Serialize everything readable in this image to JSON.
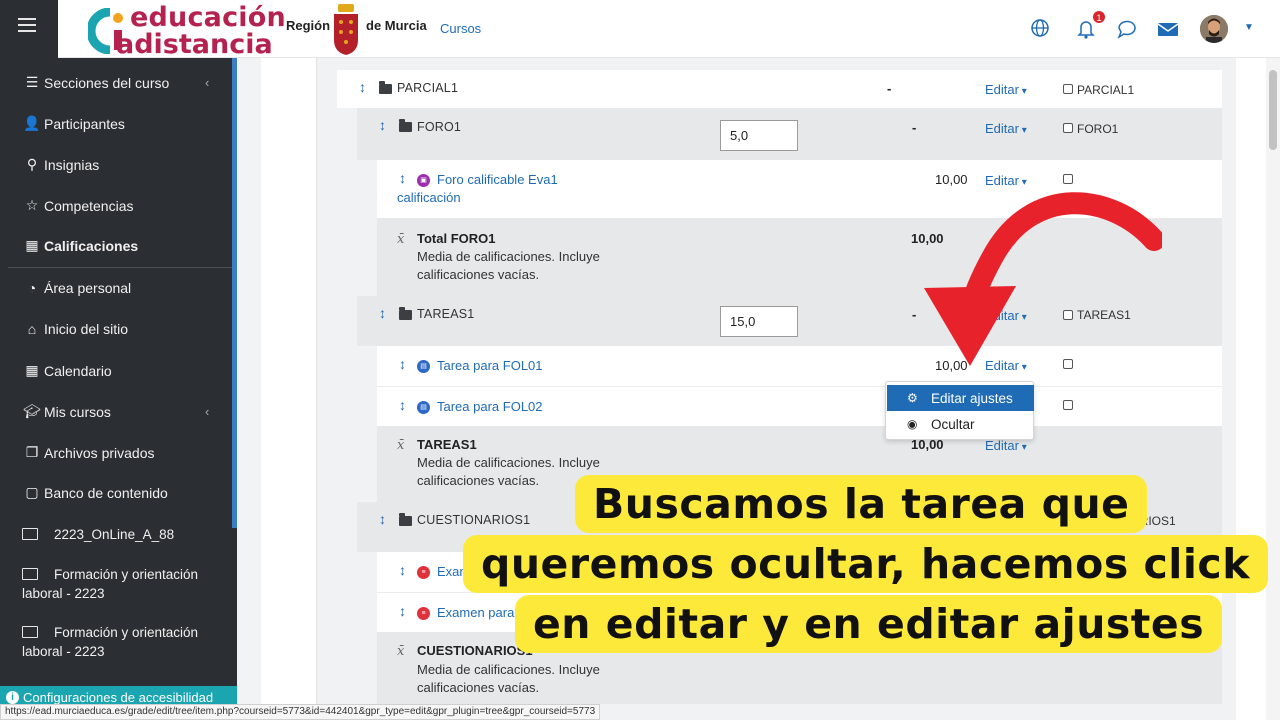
{
  "header": {
    "logo_line1": "educación",
    "logo_line2": "adistancia",
    "region": "Región",
    "de_murcia": "de Murcia",
    "cursos": "Cursos",
    "notification_count": "1"
  },
  "sidebar": {
    "items": [
      {
        "label": "Secciones del curso",
        "icon": "list-icon"
      },
      {
        "label": "Participantes",
        "icon": "users-icon"
      },
      {
        "label": "Insignias",
        "icon": "badge-icon"
      },
      {
        "label": "Competencias",
        "icon": "star-icon"
      },
      {
        "label": "Calificaciones",
        "icon": "table-icon"
      },
      {
        "label": "Área personal",
        "icon": "dashboard-icon"
      },
      {
        "label": "Inicio del sitio",
        "icon": "home-icon"
      },
      {
        "label": "Calendario",
        "icon": "calendar-icon"
      },
      {
        "label": "Mis cursos",
        "icon": "graduation-cap-icon"
      },
      {
        "label": "Archivos privados",
        "icon": "file-icon"
      },
      {
        "label": "Banco de contenido",
        "icon": "clipboard-icon"
      }
    ],
    "courses": [
      {
        "label": "2223_OnLine_A_88"
      },
      {
        "label1": "Formación y orientación",
        "label2": "laboral - 2223"
      },
      {
        "label1": "Formación y orientación",
        "label2": "laboral - 2223"
      }
    ],
    "accessibility": "Configuraciones de accesibilidad"
  },
  "gradebook": {
    "parcial": {
      "name": "PARCIAL1",
      "dash": "-",
      "edit": "Editar",
      "check_label": "PARCIAL1"
    },
    "foro": {
      "name": "FORO1",
      "weight": "5,0",
      "dash": "-",
      "edit": "Editar",
      "check_label": "FORO1"
    },
    "foro_item": {
      "line1": "Foro calificable Eva1",
      "line2": "calificación",
      "value": "10,00",
      "edit": "Editar"
    },
    "total_foro": {
      "title": "Total FORO1",
      "sub1": "Media de calificaciones. Incluye",
      "sub2": "calificaciones vacías.",
      "value": "10,00"
    },
    "tareas": {
      "name": "TAREAS1",
      "weight": "15,0",
      "dash": "-",
      "edit": "Editar",
      "check_label": "TAREAS1"
    },
    "tarea1": {
      "name": "Tarea para FOL01",
      "value": "10,00",
      "edit": "Editar"
    },
    "tarea2": {
      "name": "Tarea para FOL02"
    },
    "total_tareas": {
      "title": "TAREAS1",
      "sub1": "Media de calificaciones. Incluye",
      "sub2": "calificaciones vacías.",
      "value": "10,00",
      "edit": "Editar"
    },
    "cuestionarios": {
      "name": "CUESTIONARIOS1",
      "check_label": "ESTIONARIOS1"
    },
    "examen1": {
      "name": "Exam"
    },
    "examen2": {
      "name": "Examen para"
    },
    "total_cuestionarios": {
      "title": "CUESTIONARIOS1",
      "sub1": "Media de calificaciones. Incluye",
      "sub2": "calificaciones vacías."
    }
  },
  "dropdown": {
    "edit_settings": "Editar ajustes",
    "hide": "Ocultar"
  },
  "caption": {
    "line1": "Buscamos la tarea que",
    "line2": "queremos ocultar, hacemos click",
    "line3": "en editar y en editar ajustes"
  },
  "status_url": "https://ead.murciaeduca.es/grade/edit/tree/item.php?courseid=5773&id=442401&gpr_type=edit&gpr_plugin=tree&gpr_courseid=5773",
  "colors": {
    "accent": "#1f6bb5",
    "sidebar": "#2b2f33",
    "caption": "#fde93a",
    "arrow": "#e8222b"
  }
}
